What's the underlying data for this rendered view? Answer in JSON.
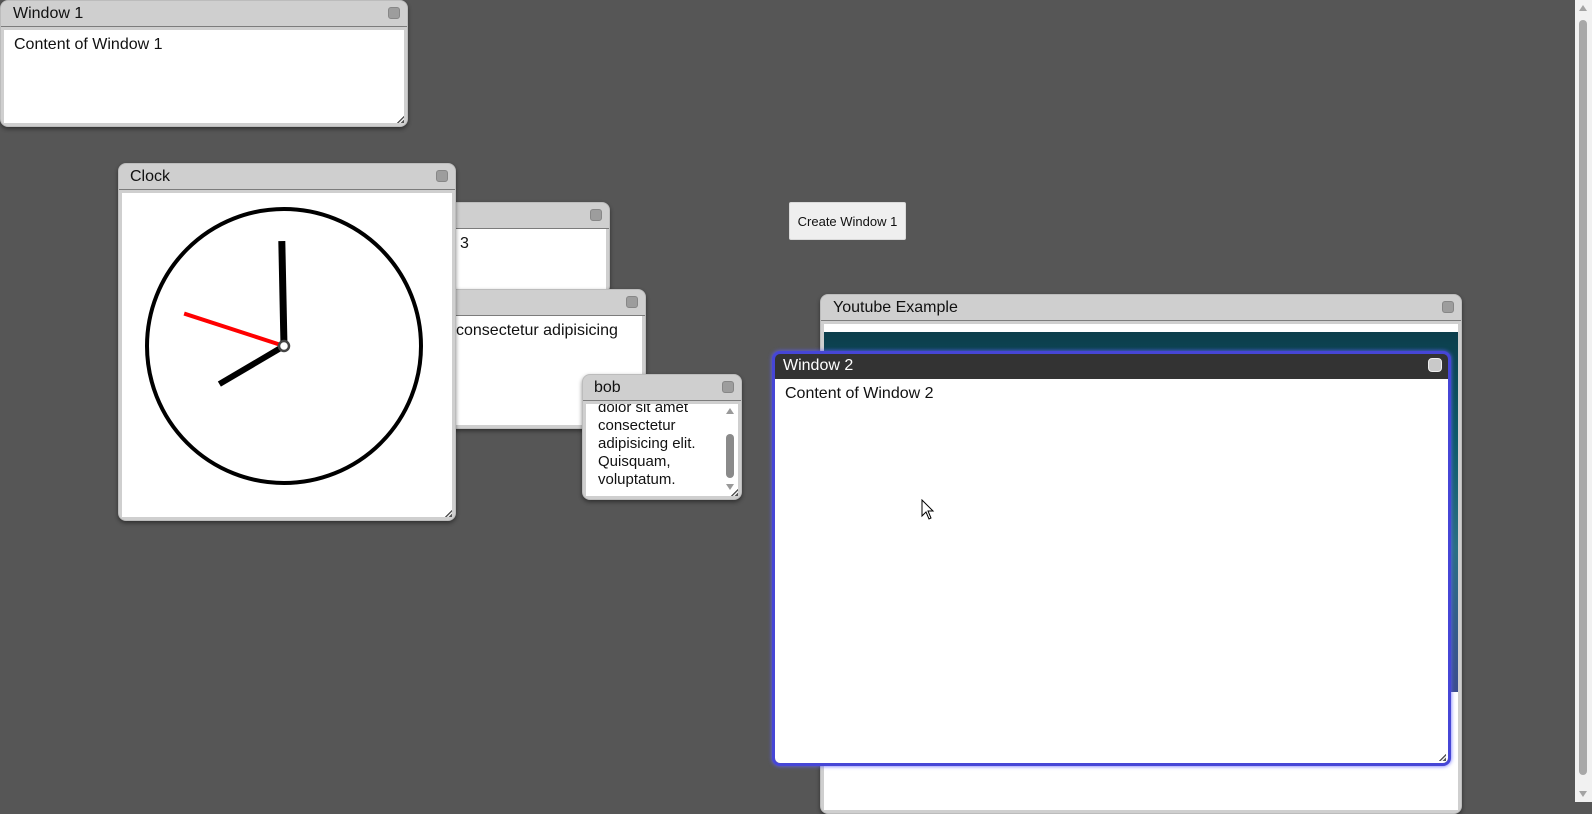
{
  "windows": {
    "window1": {
      "title": "Window 1",
      "content": "Content of Window 1"
    },
    "window3": {
      "content_fragment": "3"
    },
    "lorem": {
      "content_fragment": "consectetur adipisicing"
    },
    "clock": {
      "title": "Clock"
    },
    "bob": {
      "title": "bob",
      "lines": [
        "dolor sit amet",
        "consectetur",
        "adipisicing elit.",
        "Quisquam,",
        "voluptatum."
      ]
    },
    "youtube": {
      "title": "Youtube Example"
    },
    "window2": {
      "title": "Window 2",
      "content": "Content of Window 2"
    }
  },
  "create_button": {
    "label": "Create Window 1"
  },
  "clock_time": {
    "hour": 7,
    "minute": 59,
    "second": 48
  },
  "colors": {
    "desktop": "#565656",
    "focus_border": "#4646d6",
    "second_hand": "#ff0000"
  },
  "icons": {
    "close": "close-icon",
    "resize": "resize-grip-icon",
    "cursor": "mouse-pointer-icon"
  }
}
